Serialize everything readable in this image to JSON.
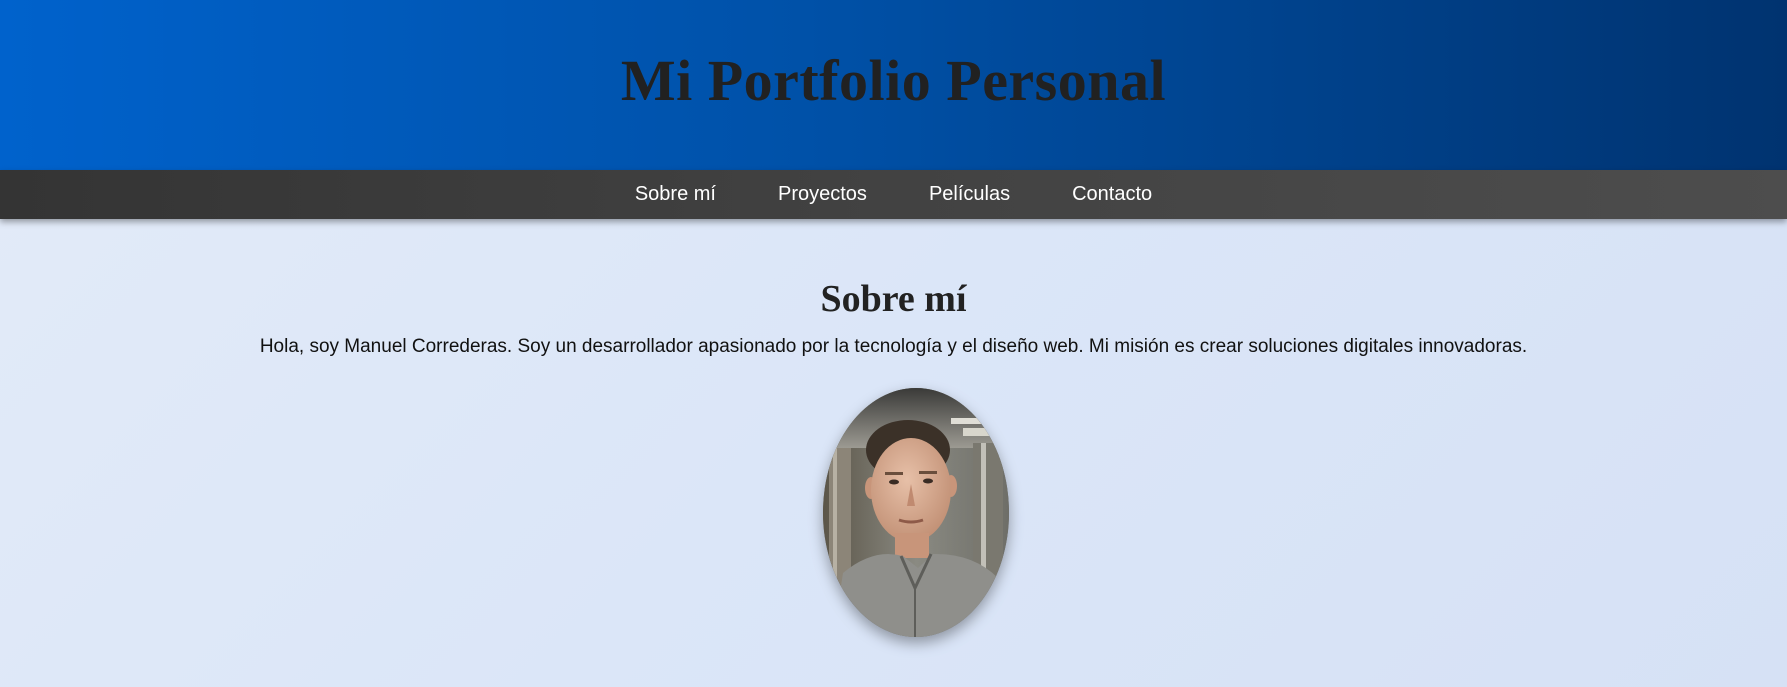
{
  "header": {
    "title": "Mi Portfolio Personal"
  },
  "nav": {
    "items": [
      {
        "label": "Sobre mí"
      },
      {
        "label": "Proyectos"
      },
      {
        "label": "Películas"
      },
      {
        "label": "Contacto"
      }
    ]
  },
  "about": {
    "heading": "Sobre mí",
    "text": "Hola, soy Manuel Correderas. Soy un desarrollador apasionado por la tecnología y el diseño web. Mi misión es crear soluciones digitales innovadoras.",
    "photo_alt": "Manuel Correderas"
  },
  "colors": {
    "header_start": "#0062cc",
    "header_end": "#003370",
    "nav_bg": "#3c3c3c",
    "page_bg": "#dde7f8"
  }
}
